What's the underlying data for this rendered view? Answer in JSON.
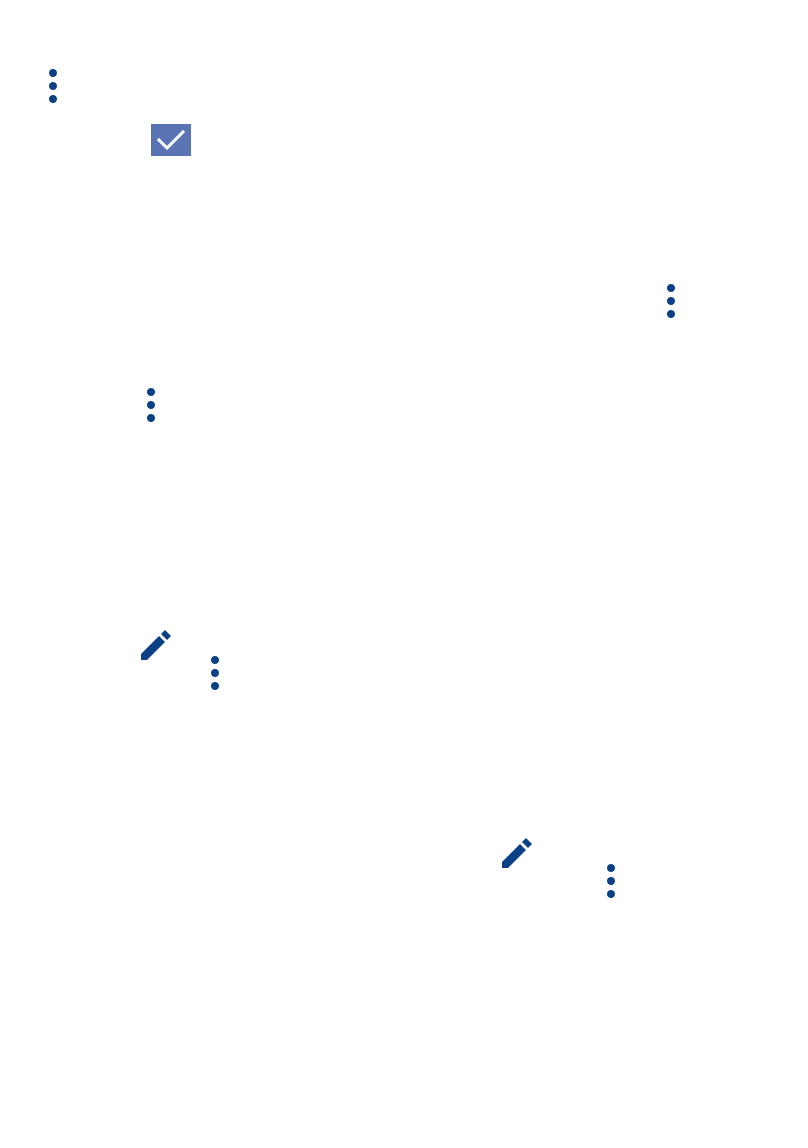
{
  "colors": {
    "icon_blue": "#0b3f86",
    "checkbox_fill": "#5a73b3",
    "checkmark": "#ffffff"
  },
  "icons": [
    "more-vert-icon",
    "checkbox-checked-icon",
    "more-vert-icon",
    "more-vert-icon",
    "pencil-edit-icon",
    "more-vert-icon",
    "pencil-edit-icon",
    "more-vert-icon"
  ]
}
